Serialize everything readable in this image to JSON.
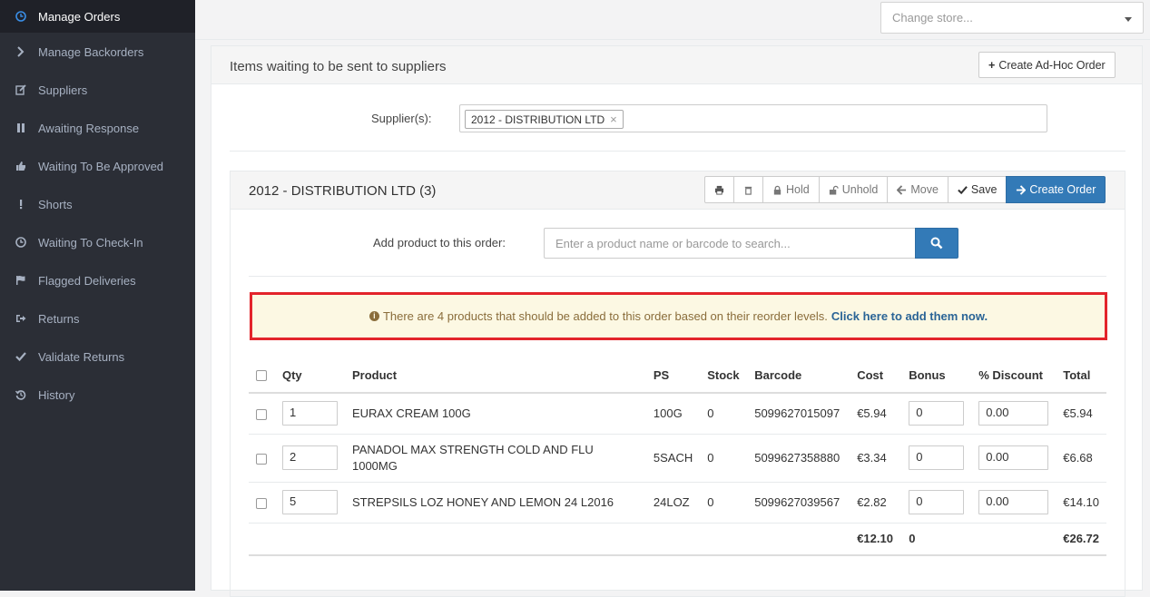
{
  "sidebar": {
    "items": [
      {
        "label": "Manage Orders",
        "icon": "clock-icon"
      },
      {
        "label": "Manage Backorders",
        "icon": "chevron-right-icon"
      },
      {
        "label": "Suppliers",
        "icon": "edit-icon"
      },
      {
        "label": "Awaiting Response",
        "icon": "pause-icon"
      },
      {
        "label": "Waiting To Be Approved",
        "icon": "thumbs-up-icon"
      },
      {
        "label": "Shorts",
        "icon": "exclamation-icon"
      },
      {
        "label": "Waiting To Check-In",
        "icon": "clock-icon"
      },
      {
        "label": "Flagged Deliveries",
        "icon": "flag-icon"
      },
      {
        "label": "Returns",
        "icon": "sign-out-icon"
      },
      {
        "label": "Validate Returns",
        "icon": "check-icon"
      },
      {
        "label": "History",
        "icon": "history-icon"
      }
    ]
  },
  "topbar": {
    "store_placeholder": "Change store..."
  },
  "panel": {
    "title": "Items waiting to be sent to suppliers",
    "adhoc_label": "Create Ad-Hoc Order",
    "supplier_label": "Supplier(s):",
    "supplier_tag": "2012 - DISTRIBUTION LTD",
    "supplier_tag_remove": "×"
  },
  "order": {
    "title": "2012 - DISTRIBUTION LTD (3)",
    "buttons": {
      "hold": "Hold",
      "unhold": "Unhold",
      "move": "Move",
      "save": "Save",
      "create": "Create Order"
    },
    "add_label": "Add product to this order:",
    "search_placeholder": "Enter a product name or barcode to search...",
    "alert_text": "There are 4 products that should be added to this order based on their reorder levels.",
    "alert_link": "Click here to add them now.",
    "columns": [
      "Qty",
      "Product",
      "PS",
      "Stock",
      "Barcode",
      "Cost",
      "Bonus",
      "% Discount",
      "Total"
    ],
    "rows": [
      {
        "qty": "1",
        "product": "EURAX CREAM 100G",
        "ps": "100G",
        "stock": "0",
        "barcode": "5099627015097",
        "cost": "€5.94",
        "bonus": "0",
        "discount": "0.00",
        "total": "€5.94"
      },
      {
        "qty": "2",
        "product": "PANADOL MAX STRENGTH COLD AND FLU 1000MG",
        "ps": "5SACH",
        "stock": "0",
        "barcode": "5099627358880",
        "cost": "€3.34",
        "bonus": "0",
        "discount": "0.00",
        "total": "€6.68"
      },
      {
        "qty": "5",
        "product": "STREPSILS LOZ HONEY AND LEMON 24 L2016",
        "ps": "24LOZ",
        "stock": "0",
        "barcode": "5099627039567",
        "cost": "€2.82",
        "bonus": "0",
        "discount": "0.00",
        "total": "€14.10"
      }
    ],
    "totals": {
      "cost": "€12.10",
      "bonus": "0",
      "total": "€26.72"
    }
  }
}
